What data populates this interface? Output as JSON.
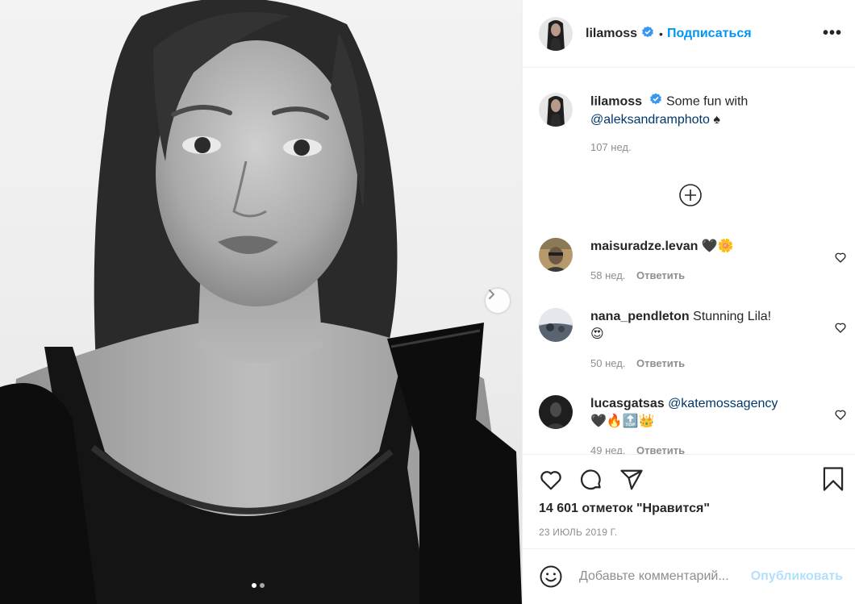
{
  "post": {
    "username": "lilamoss",
    "follow_label": "Подписаться",
    "bullet": "•",
    "more_label": "•••",
    "caption_text": "Some fun with",
    "caption_mention": "@aleksandramphoto",
    "caption_emoji": "♠",
    "caption_time": "107 нед.",
    "likes": "14 601 отметок \"Нравится\"",
    "date": "23 ИЮЛЬ 2019 Г.",
    "carousel": {
      "current": 1,
      "total": 2
    }
  },
  "comments": [
    {
      "user": "maisuradze.levan",
      "text": "",
      "mention": "",
      "emoji": "🖤🌼",
      "time": "58 нед.",
      "reply": "Ответить"
    },
    {
      "user": "nana_pendleton",
      "text": "Stunning Lila!",
      "mention": "",
      "emoji": "😍",
      "time": "50 нед.",
      "reply": "Ответить"
    },
    {
      "user": "lucasgatsas",
      "text": "",
      "mention": "@katemossagency",
      "emoji": "🖤🔥🔝👑",
      "time": "49 нед.",
      "reply": "Ответить"
    }
  ],
  "add_comment": {
    "placeholder": "Добавьте комментарий...",
    "publish_label": "Опубликовать"
  },
  "colors": {
    "accent": "#0095f6",
    "verified": "#3897f0",
    "text": "#262626",
    "muted": "#8e8e8e",
    "publish_disabled": "#b2dffc"
  }
}
